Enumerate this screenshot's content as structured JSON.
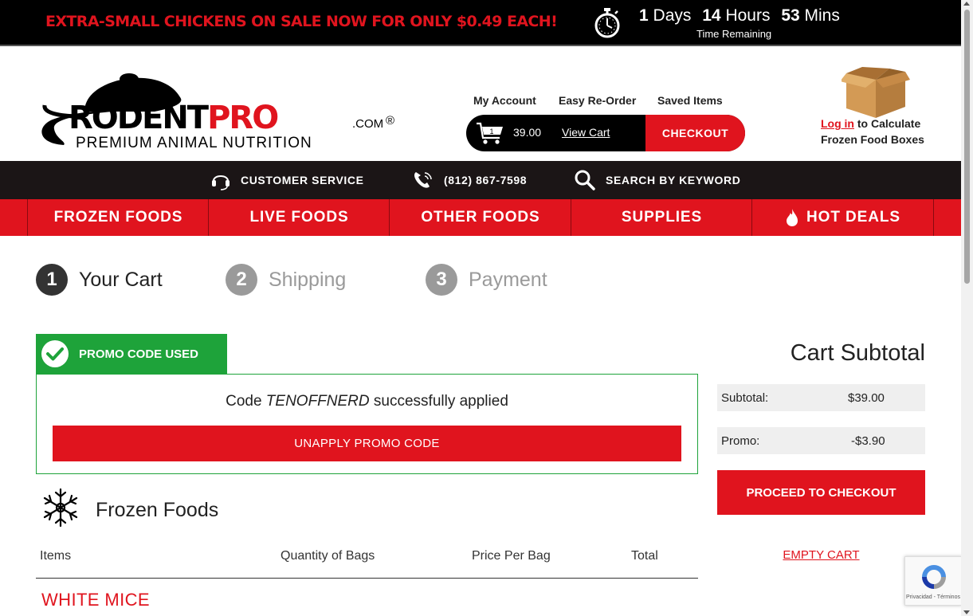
{
  "promo_bar": {
    "message": "EXTRA-SMALL CHICKENS ON SALE NOW FOR ONLY $0.49 EACH!",
    "countdown": {
      "days_value": "1",
      "days_label": "Days",
      "hours_value": "14",
      "hours_label": "Hours",
      "mins_value": "53",
      "mins_label": "Mins",
      "caption": "Time Remaining"
    }
  },
  "header": {
    "logo": {
      "brand": "RODENTPRO",
      "brand_part1": "RODENT",
      "brand_part2": "PRO",
      "domain": ".COM",
      "registered": "®",
      "tagline": "PREMIUM ANIMAL NUTRITION"
    },
    "account_links": [
      "My Account",
      "Easy Re-Order",
      "Saved Items"
    ],
    "cart": {
      "item_count": "1",
      "total": "39.00",
      "view_cart_label": "View Cart",
      "checkout_label": "CHECKOUT"
    },
    "login": {
      "link_label": "Log in",
      "line1_rest": " to Calculate",
      "line2": "Frozen Food Boxes"
    }
  },
  "utility_bar": {
    "customer_service": "CUSTOMER SERVICE",
    "phone": "(812) 867-7598",
    "search": "SEARCH BY KEYWORD"
  },
  "main_nav": [
    "FROZEN FOODS",
    "LIVE FOODS",
    "OTHER FOODS",
    "SUPPLIES",
    "HOT DEALS"
  ],
  "steps": [
    {
      "number": "1",
      "label": "Your Cart",
      "active": true
    },
    {
      "number": "2",
      "label": "Shipping",
      "active": false
    },
    {
      "number": "3",
      "label": "Payment",
      "active": false
    }
  ],
  "promo": {
    "tag": "PROMO CODE USED",
    "msg_prefix": "Code ",
    "code": "TENOFFNERD",
    "msg_suffix": " successfully applied",
    "unapply_label": "UNAPPLY PROMO CODE"
  },
  "frozen_section": {
    "title": "Frozen Foods",
    "columns": [
      "Items",
      "Quantity of Bags",
      "Price Per Bag",
      "Total"
    ],
    "product": "WHITE MICE"
  },
  "summary": {
    "title": "Cart Subtotal",
    "subtotal_label": "Subtotal:",
    "subtotal_value": "$39.00",
    "promo_label": "Promo:",
    "promo_value": "-$3.90",
    "proceed_label": "PROCEED TO CHECKOUT",
    "empty_cart_label": "EMPTY CART"
  },
  "recaptcha": {
    "text": "Privacidad - Términos"
  },
  "colors": {
    "brand_red": "#e0141e",
    "promo_green": "#1ea33a",
    "black": "#000000",
    "util_bar": "#1b1516"
  },
  "icons": [
    "stopwatch-icon",
    "cart-icon",
    "box-icon",
    "headset-icon",
    "phone-icon",
    "search-icon",
    "flame-icon",
    "check-icon",
    "snowflake-icon",
    "recaptcha-icon"
  ]
}
